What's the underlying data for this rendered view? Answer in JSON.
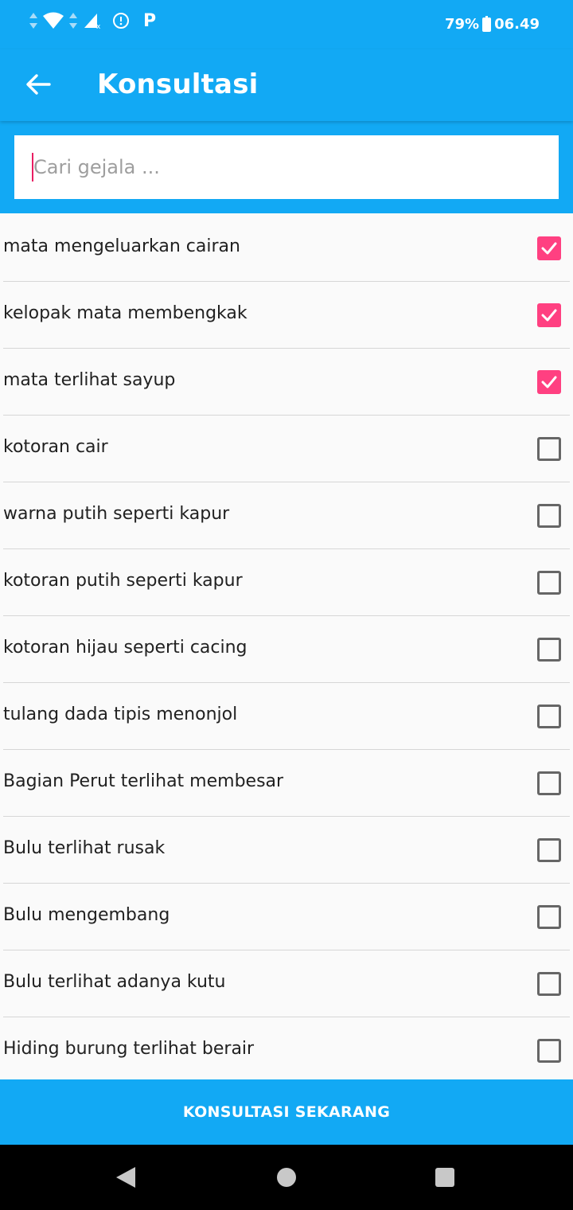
{
  "status_bar": {
    "battery_percent": "79%",
    "time": "06.49",
    "app_indicator": "P"
  },
  "app_bar": {
    "title": "Konsultasi",
    "back_icon": "arrow-left-icon"
  },
  "search": {
    "placeholder": "Cari gejala ...",
    "value": ""
  },
  "symptoms": [
    {
      "label": "mata mengeluarkan cairan",
      "checked": true
    },
    {
      "label": "kelopak mata membengkak",
      "checked": true
    },
    {
      "label": "mata terlihat sayup",
      "checked": true
    },
    {
      "label": "kotoran cair",
      "checked": false
    },
    {
      "label": "warna putih seperti kapur",
      "checked": false
    },
    {
      "label": "kotoran putih seperti kapur",
      "checked": false
    },
    {
      "label": "kotoran hijau seperti cacing",
      "checked": false
    },
    {
      "label": "tulang dada tipis menonjol",
      "checked": false
    },
    {
      "label": "Bagian Perut terlihat membesar",
      "checked": false
    },
    {
      "label": "Bulu terlihat rusak",
      "checked": false
    },
    {
      "label": "Bulu mengembang",
      "checked": false
    },
    {
      "label": "Bulu terlihat adanya kutu",
      "checked": false
    },
    {
      "label": "Hiding burung terlihat berair",
      "checked": false
    }
  ],
  "cta": {
    "label": "KONSULTASI SEKARANG"
  },
  "colors": {
    "primary": "#12a9f4",
    "accent": "#ff4081"
  }
}
